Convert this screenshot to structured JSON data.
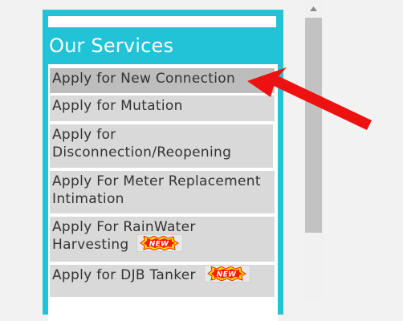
{
  "services_panel": {
    "title": "Our Services",
    "items": [
      {
        "label": "Apply for New Connection",
        "new": false,
        "active": true
      },
      {
        "label": "Apply for Mutation",
        "new": false,
        "active": false
      },
      {
        "label": "Apply for Disconnection/Reopening",
        "new": false,
        "active": false
      },
      {
        "label": "Apply For Meter Replacement Intimation",
        "new": false,
        "active": false
      },
      {
        "label": "Apply For RainWater Harvesting",
        "new": true,
        "active": false
      },
      {
        "label": "Apply for DJB Tanker",
        "new": true,
        "active": false
      }
    ],
    "new_badge_text": "NEW"
  },
  "colors": {
    "panel_accent": "#22c3d6",
    "item_background": "#d9d9d9",
    "item_active_background": "#bdbdbd",
    "annotation_arrow": "#ee1111"
  },
  "icons": {
    "annotation": "red-arrow-icon",
    "badge": "new-starburst-icon",
    "scroll": "chevron-up-icon"
  }
}
